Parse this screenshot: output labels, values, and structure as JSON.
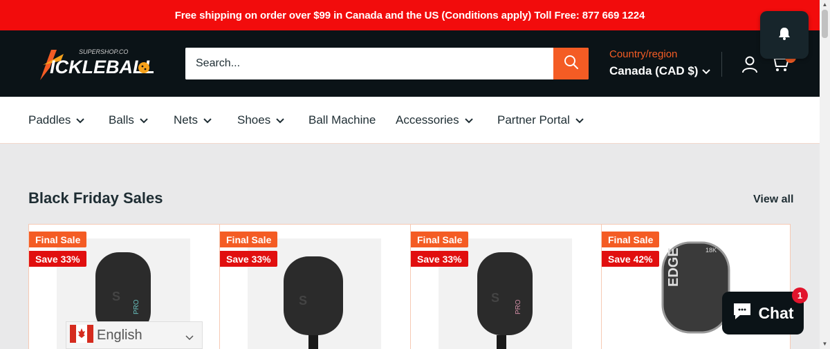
{
  "announcement": "Free shipping on order over $99 in Canada and the US (Conditions apply) Toll Free: 877 669 1224",
  "logo": {
    "text": "PICKLEBALL",
    "subtext": "SUPERSHOP.CO"
  },
  "search": {
    "placeholder": "Search...",
    "icon": "search-icon"
  },
  "country": {
    "label": "Country/region",
    "value": "Canada (CAD $)"
  },
  "header_icons": [
    "account-icon",
    "cart-icon"
  ],
  "nav": [
    {
      "label": "Paddles",
      "dropdown": true
    },
    {
      "label": "Balls",
      "dropdown": true
    },
    {
      "label": "Nets",
      "dropdown": true
    },
    {
      "label": "Shoes",
      "dropdown": true
    },
    {
      "label": "Ball Machine",
      "dropdown": false
    },
    {
      "label": "Accessories",
      "dropdown": true
    },
    {
      "label": "Partner Portal",
      "dropdown": true
    }
  ],
  "section": {
    "title": "Black Friday Sales",
    "view_all": "View all"
  },
  "products": [
    {
      "tag": "Final Sale",
      "discount": "Save 33%"
    },
    {
      "tag": "Final Sale",
      "discount": "Save 33%"
    },
    {
      "tag": "Final Sale",
      "discount": "Save 33%"
    },
    {
      "tag": "Final Sale",
      "discount": "Save 42%"
    }
  ],
  "language": {
    "label": "English",
    "flag": "canada-flag-icon"
  },
  "chat": {
    "label": "Chat",
    "badge": "1"
  },
  "colors": {
    "accent": "#f45c24",
    "announcement": "#f20c0c",
    "header_bg": "#0b1317",
    "save_badge": "#e10f0f"
  }
}
